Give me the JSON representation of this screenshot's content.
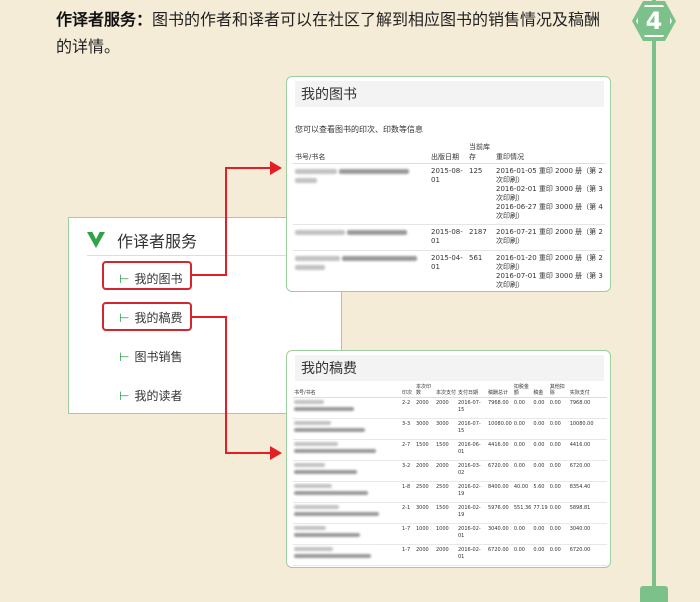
{
  "step": {
    "number": "4"
  },
  "intro": {
    "title": "作译者服务：",
    "text": "图书的作者和译者可以在社区了解到相应图书的销售情况及稿酬的详情。"
  },
  "sidebar": {
    "title": "作译者服务",
    "items": [
      {
        "label": "我的图书",
        "highlighted": true
      },
      {
        "label": "我的稿费",
        "highlighted": true
      },
      {
        "label": "图书销售",
        "highlighted": false
      },
      {
        "label": "我的读者",
        "highlighted": false
      }
    ]
  },
  "books_panel": {
    "title": "我的图书",
    "note": "您可以查看图书的印次、印数等信息",
    "columns": [
      "书号/书名",
      "出版日期",
      "当前库存",
      "重印情况"
    ],
    "rows": [
      {
        "date": "2015-08-01",
        "stock": "125",
        "reprints": [
          "2016-01-05 重印 2000 册（第 2 次印刷）",
          "2016-02-01 重印 3000 册（第 3 次印刷）",
          "2016-06-27 重印 3000 册（第 4 次印刷）"
        ]
      },
      {
        "date": "2015-08-01",
        "stock": "2187",
        "reprints": [
          "2016-07-21 重印 2000 册（第 2 次印刷）"
        ]
      },
      {
        "date": "2015-04-01",
        "stock": "561",
        "reprints": [
          "2016-01-20 重印 2000 册（第 2 次印刷）",
          "2016-07-01 重印 3000 册（第 3 次印刷）"
        ]
      }
    ]
  },
  "royalty_panel": {
    "title": "我的稿费",
    "columns": [
      "书号/书名",
      "印次",
      "本次印数",
      "本次支付",
      "支付日期",
      "稿酬总计",
      "扣税金额",
      "稿金",
      "其他扣除",
      "实际支付"
    ],
    "rows": [
      [
        "2-2",
        "2000",
        "2000",
        "2016-07-15",
        "7968.00",
        "0.00",
        "0.00",
        "0.00",
        "7968.00"
      ],
      [
        "3-3",
        "3000",
        "3000",
        "2016-07-15",
        "10080.00",
        "0.00",
        "0.00",
        "0.00",
        "10080.00"
      ],
      [
        "2-7",
        "1500",
        "1500",
        "2016-06-01",
        "4416.00",
        "0.00",
        "0.00",
        "0.00",
        "4416.00"
      ],
      [
        "3-2",
        "2000",
        "2000",
        "2016-03-02",
        "6720.00",
        "0.00",
        "0.00",
        "0.00",
        "6720.00"
      ],
      [
        "1-8",
        "2500",
        "2500",
        "2016-02-19",
        "8400.00",
        "40.00",
        "5.60",
        "0.00",
        "8354.40"
      ],
      [
        "2-1",
        "3000",
        "1500",
        "2016-02-19",
        "5976.00",
        "551.36",
        "77.19",
        "0.00",
        "5898.81"
      ],
      [
        "1-7",
        "1000",
        "1000",
        "2016-02-01",
        "3040.00",
        "0.00",
        "0.00",
        "0.00",
        "3040.00"
      ],
      [
        "1-7",
        "2000",
        "2000",
        "2016-02-01",
        "6720.00",
        "0.00",
        "0.00",
        "0.00",
        "6720.00"
      ]
    ]
  },
  "colors": {
    "accent": "#7cc08a",
    "highlight": "#e41e25",
    "background": "#f5ecd8"
  }
}
